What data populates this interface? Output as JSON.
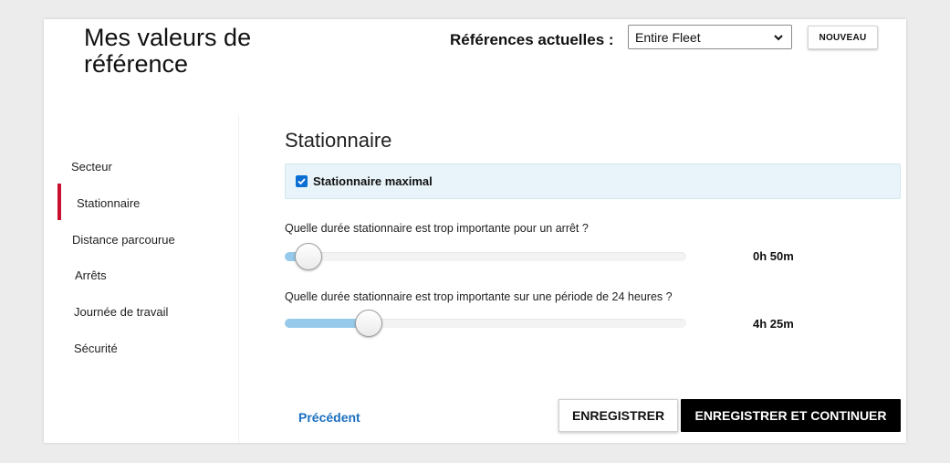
{
  "header": {
    "title": "Mes valeurs de référence",
    "ref_label": "Références actuelles :",
    "ref_select_value": "Entire Fleet",
    "new_button": "NOUVEAU"
  },
  "sidebar": {
    "items": [
      {
        "label": "Secteur",
        "active": false
      },
      {
        "label": "Stationnaire",
        "active": true
      },
      {
        "label": "Distance parcourue",
        "active": false
      },
      {
        "label": "Arrêts",
        "active": false
      },
      {
        "label": "Journée de travail",
        "active": false
      },
      {
        "label": "Sécurité",
        "active": false
      }
    ]
  },
  "main": {
    "section_title": "Stationnaire",
    "checkbox": {
      "label": "Stationnaire maximal",
      "checked": true
    },
    "sliders": [
      {
        "question": "Quelle durée stationnaire est trop importante pour un arrêt ?",
        "value_text": "0h 50m",
        "fraction": 0.045
      },
      {
        "question": "Quelle durée stationnaire est trop importante sur une période de 24 heures ?",
        "value_text": "4h 25m",
        "fraction": 0.195
      }
    ]
  },
  "footer": {
    "previous": "Précédent",
    "save": "ENREGISTRER",
    "save_continue": "ENREGISTRER ET CONTINUER"
  },
  "colors": {
    "accent": "#c8102e",
    "link": "#1a6fc1",
    "checkbox": "#0b6ed3",
    "slider_fill": "#96c9ea",
    "banner": "#e8f4f9"
  }
}
